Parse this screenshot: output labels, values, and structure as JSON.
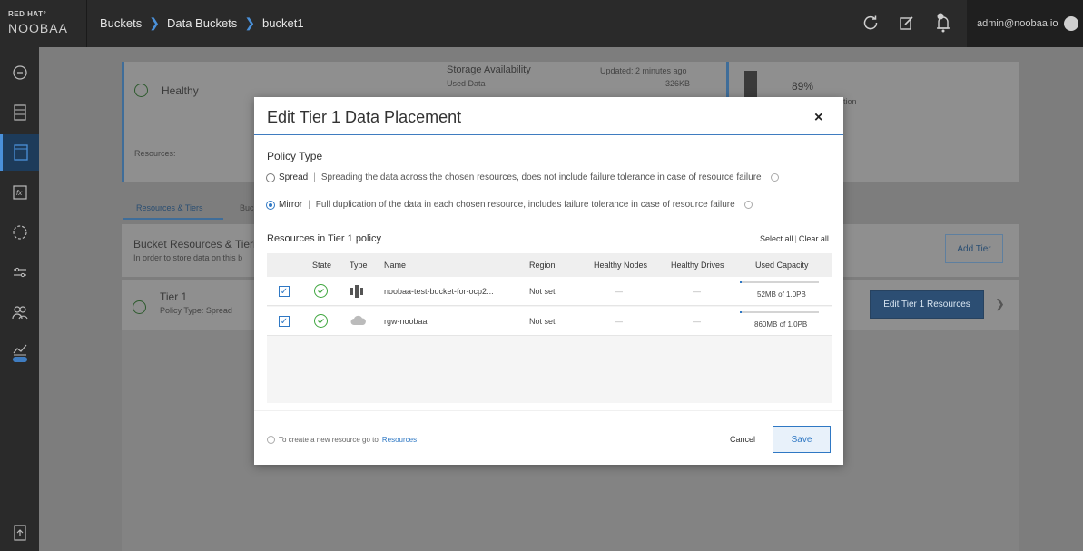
{
  "brand": {
    "top": "RED HAT°",
    "main": "NOOBAA"
  },
  "breadcrumb": [
    "Buckets",
    "Data Buckets",
    "bucket1"
  ],
  "header": {
    "user": "admin@noobaa.io"
  },
  "background": {
    "health": "Healthy",
    "storage_title": "Storage Availability",
    "storage_updated": "Updated: 2 minutes ago",
    "used_data_label": "Used Data",
    "used_data_value": "326KB",
    "optimization_value": "89%",
    "optimization_label": "Data Optimization",
    "resources_label": "Resources:",
    "tab_resources": "Resources & Tiers",
    "tab_next": "Buc",
    "section_title": "Bucket Resources & Tiering",
    "section_desc": "In order to store data on this b",
    "add_tier": "Add Tier",
    "tier_name": "Tier 1",
    "tier_policy": "Policy Type: Spread",
    "edit_tier": "Edit Tier 1 Resources"
  },
  "modal": {
    "title": "Edit Tier 1 Data Placement",
    "close": "×",
    "policy_label": "Policy Type",
    "options": [
      {
        "label": "Spread",
        "desc": "Spreading the data across the chosen resources, does not include failure tolerance in case of resource failure",
        "checked": false
      },
      {
        "label": "Mirror",
        "desc": "Full duplication of the data in each chosen resource, includes failure tolerance in case of resource failure",
        "checked": true
      }
    ],
    "resources_label": "Resources in Tier 1 policy",
    "select_all": "Select all",
    "clear_all": "Clear all",
    "columns": [
      "State",
      "Type",
      "Name",
      "Region",
      "Healthy Nodes",
      "Healthy Drives",
      "Used Capacity"
    ],
    "rows": [
      {
        "name": "noobaa-test-bucket-for-ocp2...",
        "region": "Not set",
        "healthy_nodes": "—",
        "healthy_drives": "—",
        "used": "52MB of 1.0PB",
        "usage_fraction": 0.01,
        "type": "aws-s3-icon",
        "checked": true
      },
      {
        "name": "rgw-noobaa",
        "region": "Not set",
        "healthy_nodes": "—",
        "healthy_drives": "—",
        "used": "860MB of 1.0PB",
        "usage_fraction": 0.01,
        "type": "cloud-icon",
        "checked": true
      }
    ],
    "footer_note": "To create a new resource go to",
    "footer_link": "Resources",
    "cancel": "Cancel",
    "save": "Save"
  },
  "colors": {
    "accent": "#2f78c4",
    "success": "#3fa63f",
    "topbar": "#2a2a2a"
  }
}
